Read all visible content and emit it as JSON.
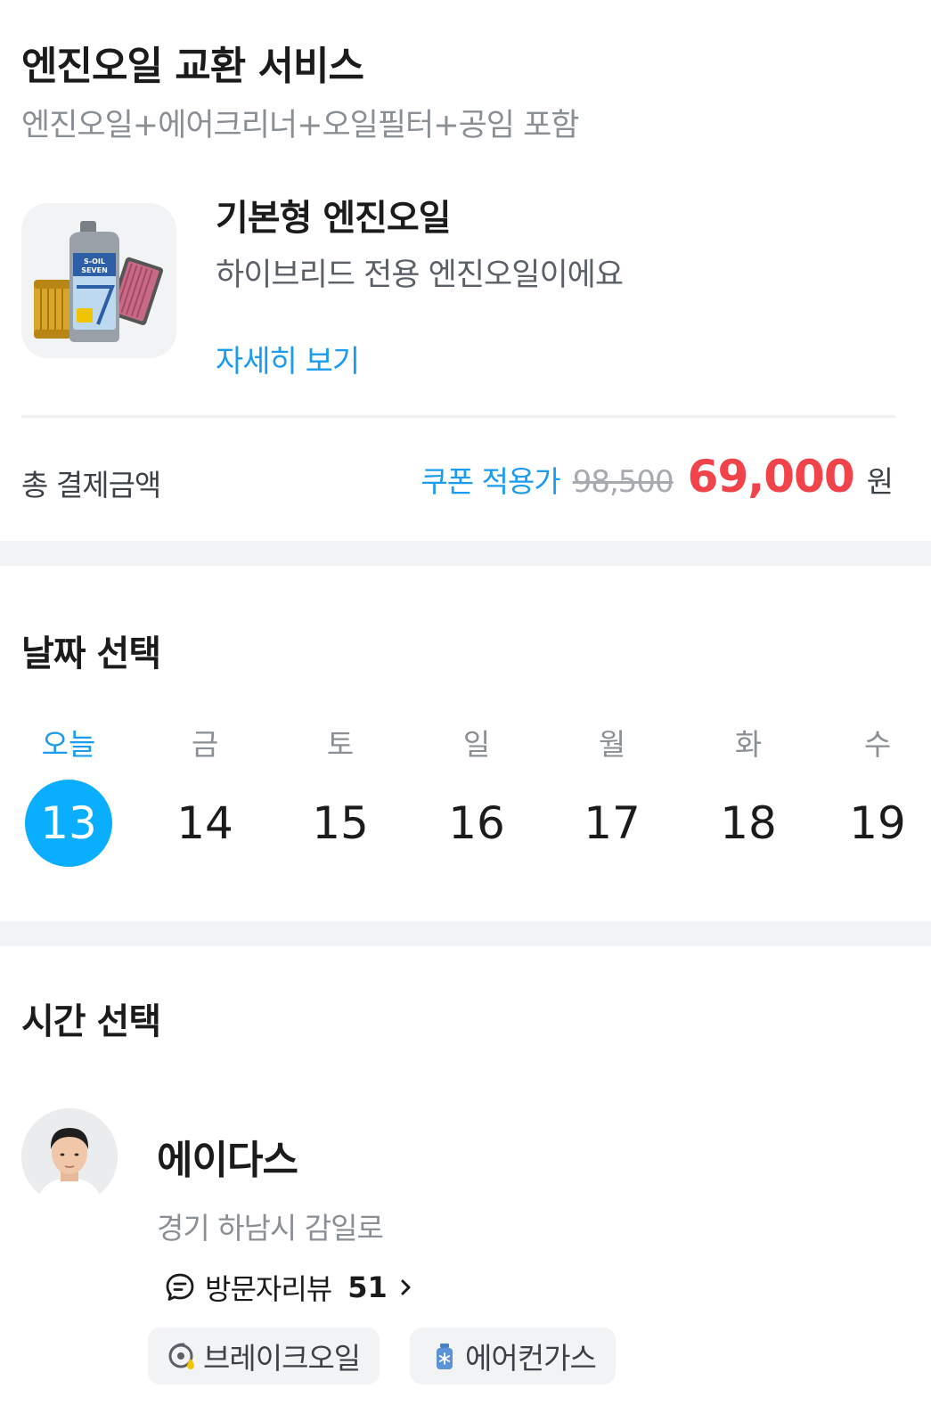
{
  "service": {
    "title": "엔진오일 교환 서비스",
    "subtitle": "엔진오일+에어크리너+오일필터+공임 포함"
  },
  "product": {
    "name": "기본형 엔진오일",
    "description": "하이브리드 전용 엔진오일이에요",
    "detail_link": "자세히 보기",
    "image_text": "S-OIL SEVEN"
  },
  "payment": {
    "total_label": "총 결제금액",
    "coupon_label": "쿠폰 적용가",
    "original_price": "98,500",
    "sale_price": "69,000",
    "currency": "원"
  },
  "date_select": {
    "title": "날짜 선택",
    "days": [
      {
        "label": "오늘",
        "date": "13",
        "selected": true
      },
      {
        "label": "금",
        "date": "14",
        "selected": false
      },
      {
        "label": "토",
        "date": "15",
        "selected": false
      },
      {
        "label": "일",
        "date": "16",
        "selected": false
      },
      {
        "label": "월",
        "date": "17",
        "selected": false
      },
      {
        "label": "화",
        "date": "18",
        "selected": false
      },
      {
        "label": "수",
        "date": "19",
        "selected": false
      }
    ]
  },
  "time_select": {
    "title": "시간 선택"
  },
  "shop": {
    "name": "에이다스",
    "address": "경기 하남시 감일로",
    "review_label": "방문자리뷰",
    "review_count": "51",
    "tags": [
      {
        "icon": "brake-oil-icon",
        "label": "브레이크오일"
      },
      {
        "icon": "aircon-gas-icon",
        "label": "에어컨가스"
      }
    ]
  },
  "colors": {
    "accent": "#0aaeff",
    "link": "#1a9cf0",
    "sale": "#f0434a"
  }
}
